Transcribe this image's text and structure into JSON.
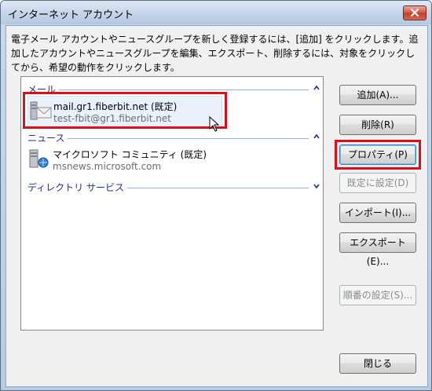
{
  "window": {
    "title": "インターネット アカウント",
    "close_glyph": "x"
  },
  "description": "電子メール アカウントやニュースグループを新しく登録するには、[追加] をクリックします。追加したアカウントやニュースグループを編集、エクスポート、削除するには、対象をクリックしてから、希望の動作をクリックします。",
  "groups": {
    "mail": {
      "label": "メール",
      "chevron": "^"
    },
    "news": {
      "label": "ニュース",
      "chevron": "^"
    },
    "directory": {
      "label": "ディレクトリ サービス",
      "chevron": "v"
    }
  },
  "accounts": {
    "mail": {
      "name": "mail.gr1.fiberbit.net (既定)",
      "address": "test-fbit@gr1.fiberbit.net",
      "icon": "mail-account-icon"
    },
    "news": {
      "name": "マイクロソフト コミュニティ (既定)",
      "address": "msnews.microsoft.com",
      "icon": "news-account-icon"
    }
  },
  "buttons": {
    "add": "追加(A)...",
    "delete": "削除(R)",
    "properties": "プロパティ(P)",
    "set_default": "既定に設定(D)",
    "import": "インポート(I)...",
    "export": "エクスポート(E)...",
    "order": "順番の設定(S)...",
    "close": "閉じる"
  },
  "colors": {
    "highlight": "#d9101a",
    "group_header": "#1e3287"
  }
}
